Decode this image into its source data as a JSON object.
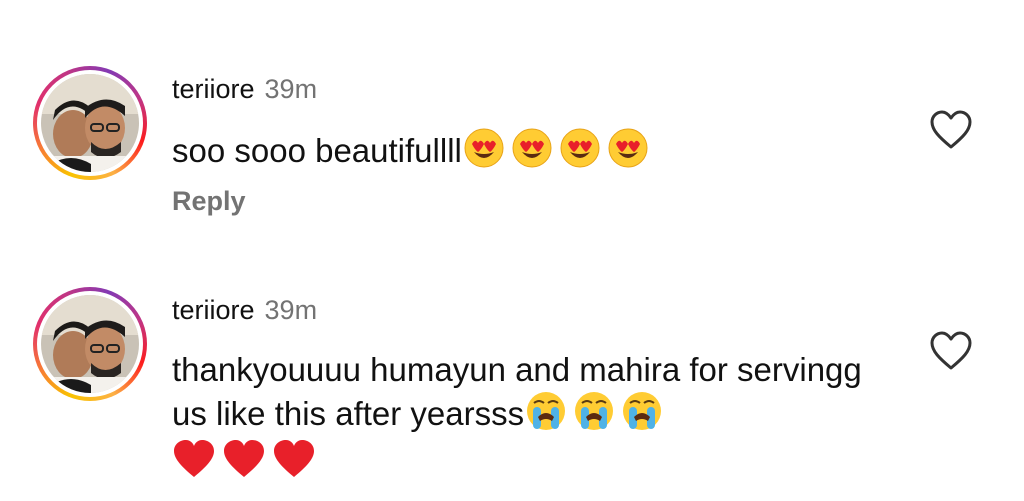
{
  "comments": [
    {
      "username": "teriiore",
      "time": "39m",
      "text": "soo sooo beautifullll",
      "emojis": [
        "heart-eyes-icon",
        "heart-eyes-icon",
        "heart-eyes-icon",
        "heart-eyes-icon"
      ],
      "reply_label": "Reply"
    },
    {
      "username": "teriiore",
      "time": "39m",
      "text": "thankyouuuu humayun and mahira for servingg us like this after yearsss",
      "emojis": [
        "loudly-crying-icon",
        "loudly-crying-icon",
        "loudly-crying-icon"
      ],
      "hearts": [
        "red-heart-icon",
        "red-heart-icon",
        "red-heart-icon"
      ]
    }
  ],
  "colors": {
    "username": "#111111",
    "meta": "#737373",
    "emoji_yellow": "#FFCC33",
    "heart_red": "#E8202A"
  }
}
